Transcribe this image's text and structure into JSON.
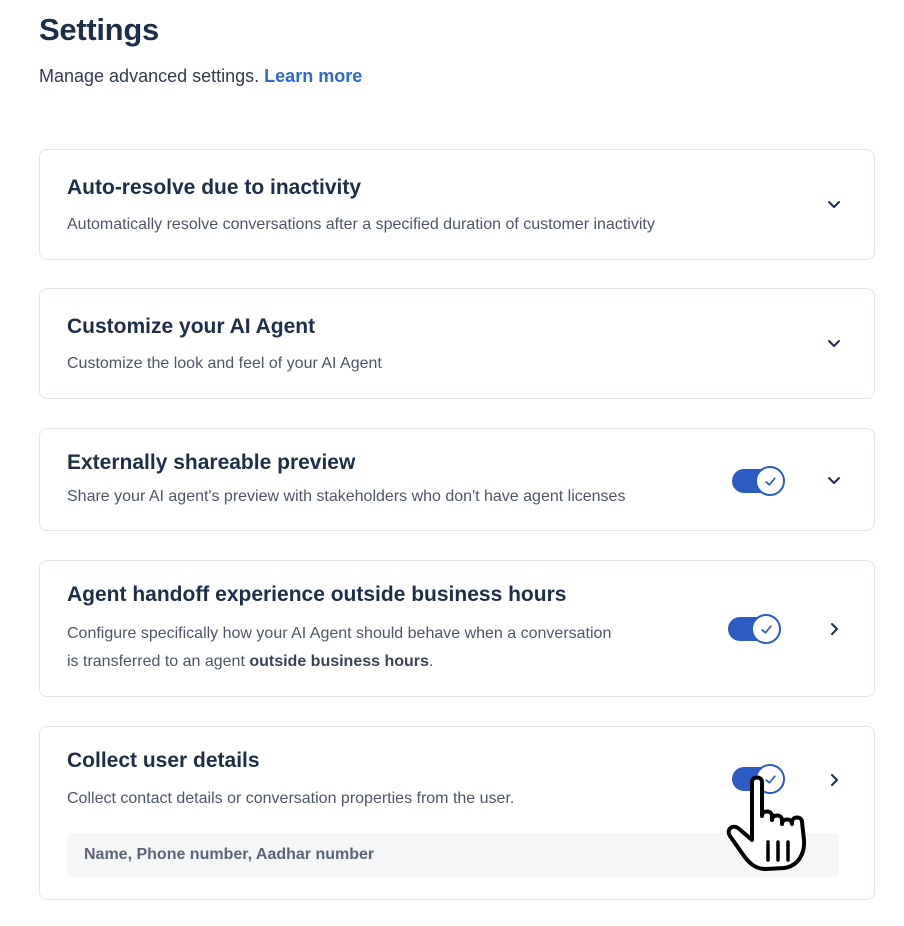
{
  "header": {
    "title": "Settings",
    "subtitle": "Manage advanced settings.",
    "learn_more": "Learn more"
  },
  "cards": [
    {
      "title": "Auto-resolve due to inactivity",
      "description": "Automatically resolve conversations after a specified duration of customer inactivity",
      "chevron": "chevron-down-icon"
    },
    {
      "title": "Customize your AI Agent",
      "description": "Customize the look and feel of your AI Agent",
      "chevron": "chevron-down-icon"
    },
    {
      "title": "Externally shareable preview",
      "description": "Share your AI agent's preview with stakeholders who don't have agent licenses",
      "toggle_on": true,
      "chevron": "chevron-down-icon"
    },
    {
      "title": "Agent handoff experience outside business hours",
      "description_line1": "Configure specifically how your AI Agent should behave when a conversation",
      "description_line2_prefix": "is transferred to an agent ",
      "description_line2_bold": "outside business hours",
      "description_line2_suffix": ".",
      "toggle_on": true,
      "chevron": "chevron-right-icon"
    },
    {
      "title": "Collect user details",
      "description": "Collect contact details or conversation properties from the user.",
      "fields": "Name, Phone number, Aadhar number",
      "toggle_on": true,
      "chevron": "chevron-right-icon"
    }
  ],
  "colors": {
    "accent": "#2d5bc4",
    "link": "#2f6ad0",
    "title": "#1c2e4a"
  }
}
